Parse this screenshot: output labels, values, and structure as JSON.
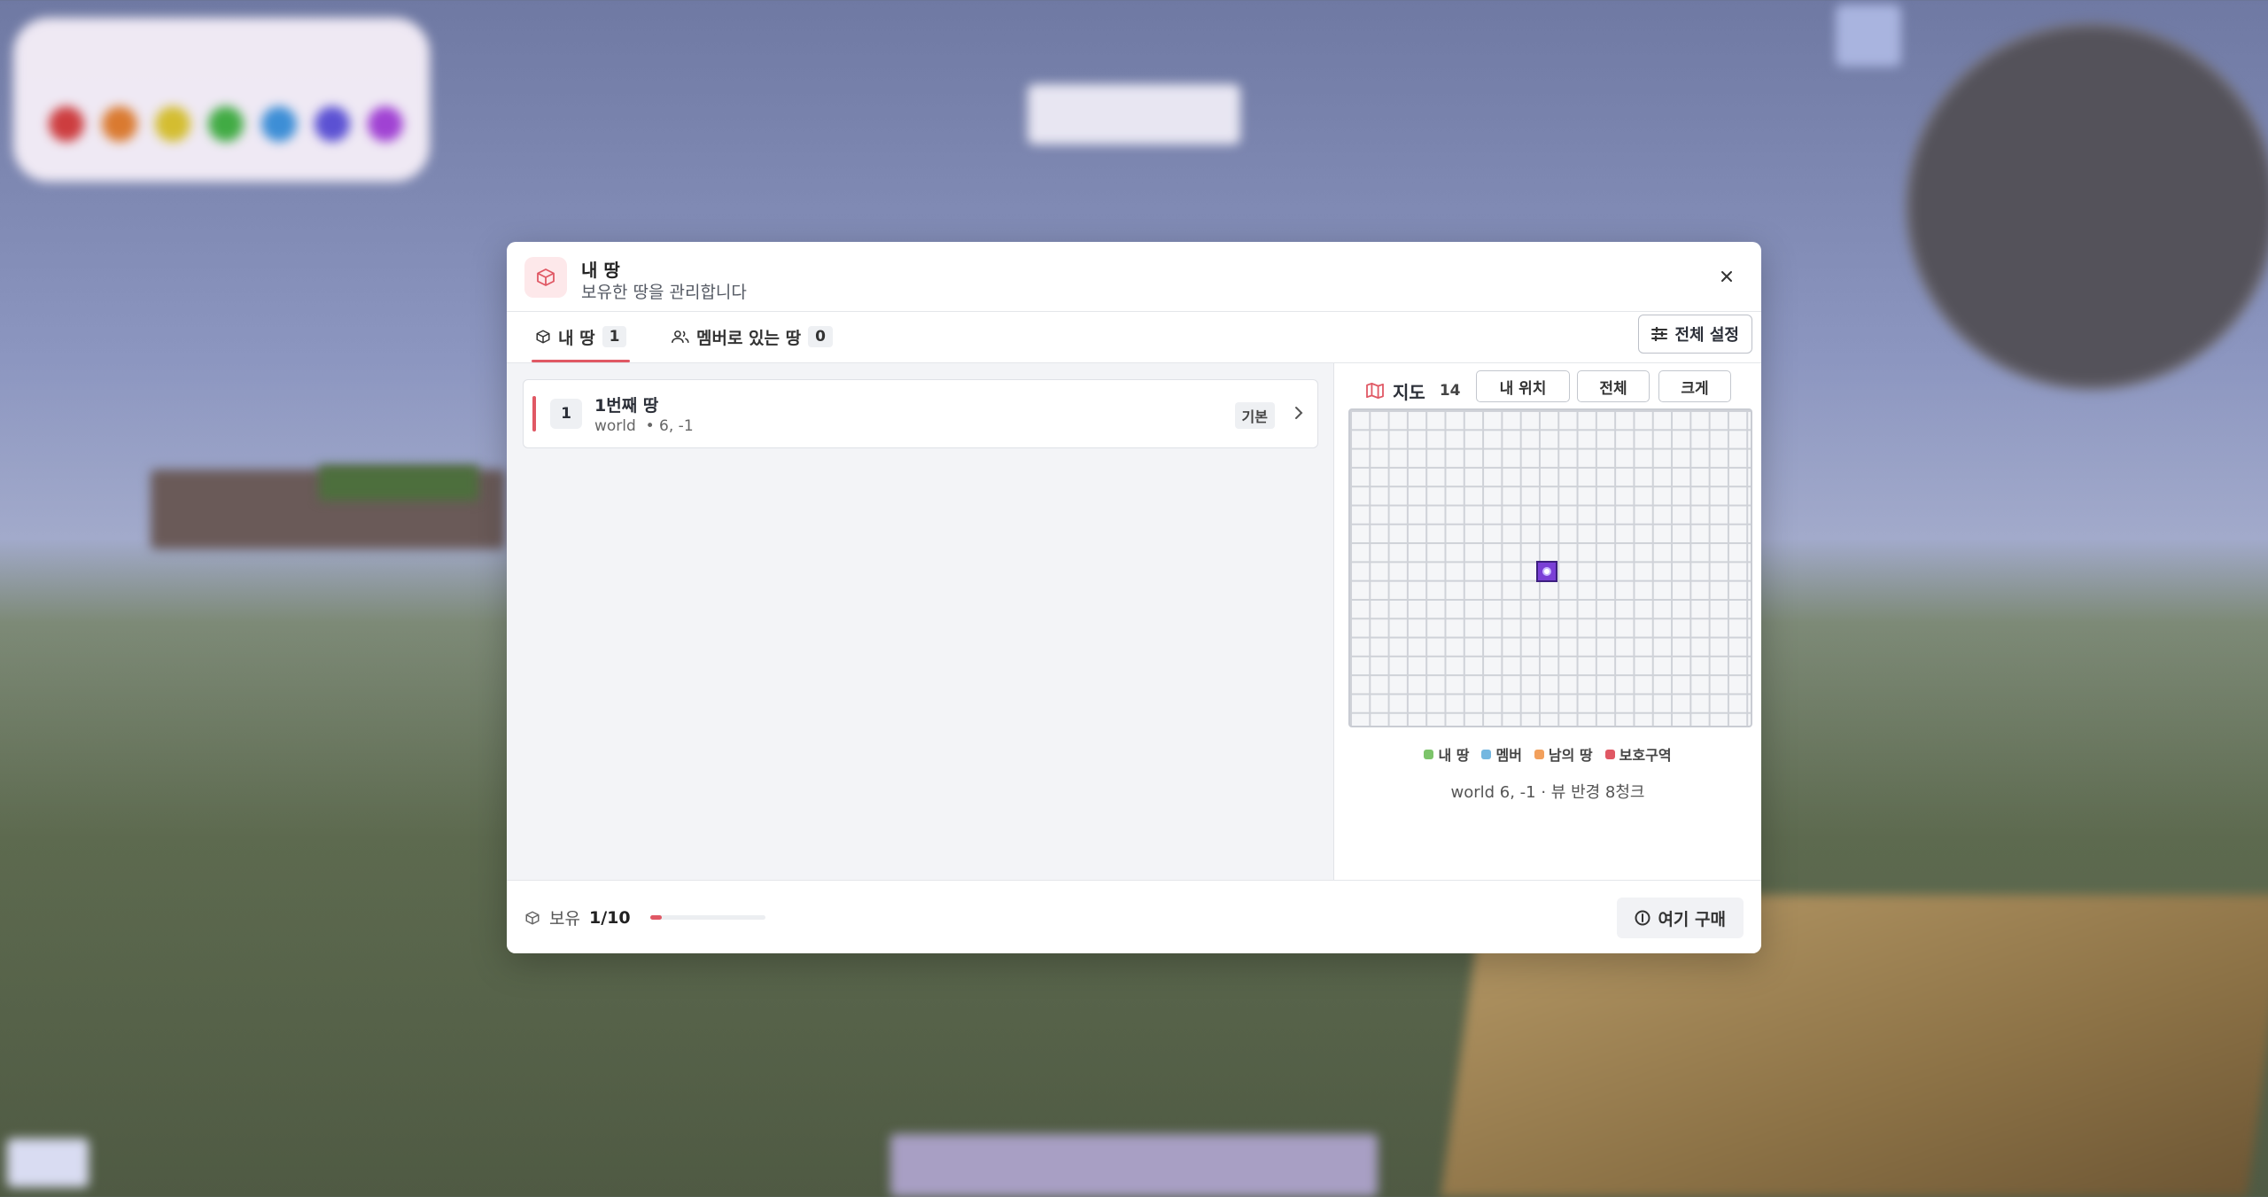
{
  "modal": {
    "title": "내 땅",
    "subtitle": "보유한 땅을 관리합니다",
    "tabs": [
      {
        "label": "내 땅",
        "count": "1"
      },
      {
        "label": "멤버로 있는 땅",
        "count": "0"
      }
    ],
    "settings_label": "전체 설정"
  },
  "lands": [
    {
      "index": "1",
      "name": "1번째 땅",
      "world": "world",
      "coords": "• 6, -1",
      "tag": "기본"
    }
  ],
  "map": {
    "label": "지도",
    "zoom": "14",
    "buttons": [
      "내 위치",
      "전체",
      "크게"
    ],
    "legend": [
      {
        "label": "내 땅",
        "color": "#7cc46a"
      },
      {
        "label": "멤버",
        "color": "#74b7e0"
      },
      {
        "label": "남의 땅",
        "color": "#f2a05c"
      },
      {
        "label": "보호구역",
        "color": "#e05864"
      }
    ],
    "footer": "world 6, -1 · 뷰 반경 8청크"
  },
  "footer": {
    "own_label": "보유",
    "own_value": "1/10",
    "own_fraction": 0.1,
    "buy_label": "여기 구매"
  },
  "colors": {
    "accent": "#e05864",
    "marker": "#7a3fd6"
  }
}
